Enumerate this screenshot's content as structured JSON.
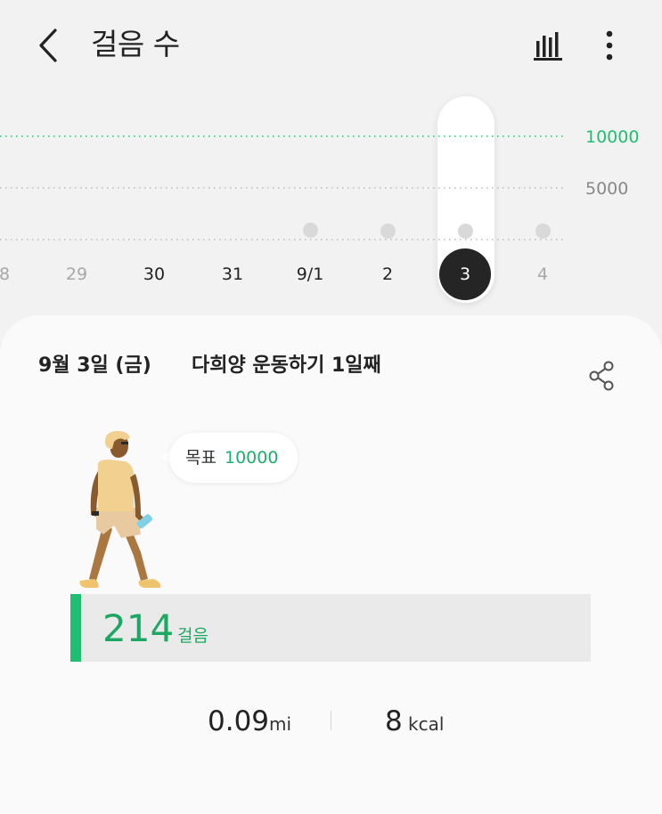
{
  "header": {
    "title": "걸음 수",
    "back_icon": "chevron-left-icon",
    "chart_icon": "bar-chart-icon",
    "more_icon": "more-vertical-icon"
  },
  "graph": {
    "goal_label": "10000",
    "mid_label": "5000",
    "dates": [
      "8",
      "29",
      "30",
      "31",
      "9/1",
      "2",
      "3",
      "4"
    ],
    "selected_date": "3",
    "colors": {
      "goal": "#1fbf72",
      "selected": "#252525"
    }
  },
  "card": {
    "date": "9월 3일 (금)",
    "challenge": "다희양 운동하기 1일째",
    "share_icon": "share-icon",
    "goal": {
      "label": "목표",
      "value": "10000"
    },
    "steps": {
      "value": "214",
      "unit": "걸음"
    },
    "distance": {
      "value": "0.09",
      "unit": "mi"
    },
    "calories": {
      "value": "8",
      "unit": "kcal"
    }
  }
}
